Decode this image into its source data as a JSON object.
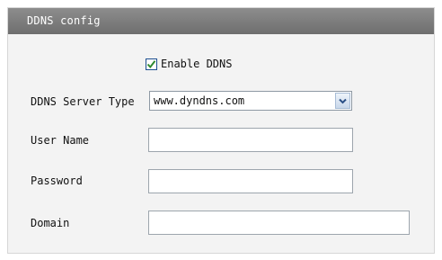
{
  "panel": {
    "title": "DDNS config"
  },
  "enable": {
    "label": "Enable DDNS",
    "checked": true
  },
  "fields": {
    "server_type": {
      "label": "DDNS Server Type",
      "value": "www.dyndns.com",
      "icon": "chevron-down-icon"
    },
    "user_name": {
      "label": "User Name",
      "value": ""
    },
    "password": {
      "label": "Password",
      "value": ""
    },
    "domain": {
      "label": "Domain",
      "value": ""
    }
  },
  "colors": {
    "header_bg": "#7b7b7b",
    "panel_bg": "#f3f3f3",
    "check_mark": "#2f8a2f"
  }
}
